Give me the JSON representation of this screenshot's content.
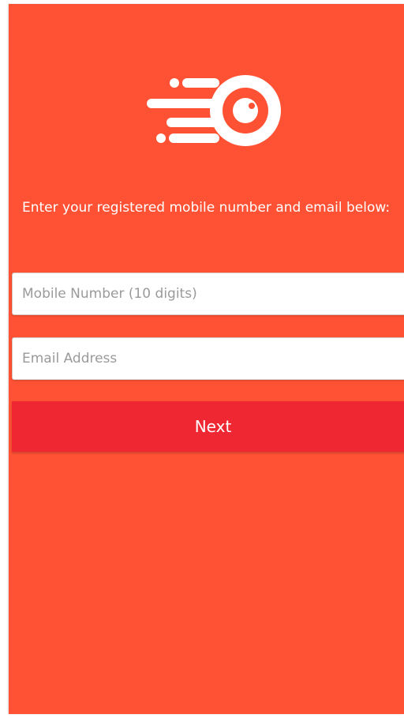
{
  "app": {
    "logo_icon": "comet-eye-logo-icon",
    "background_color": "#ff5234",
    "button_color": "#ee2733"
  },
  "form": {
    "prompt": "Enter your registered mobile number and email below:",
    "mobile_value": "",
    "mobile_placeholder": "Mobile Number (10 digits)",
    "email_value": "",
    "email_placeholder": "Email Address",
    "next_label": "Next"
  }
}
